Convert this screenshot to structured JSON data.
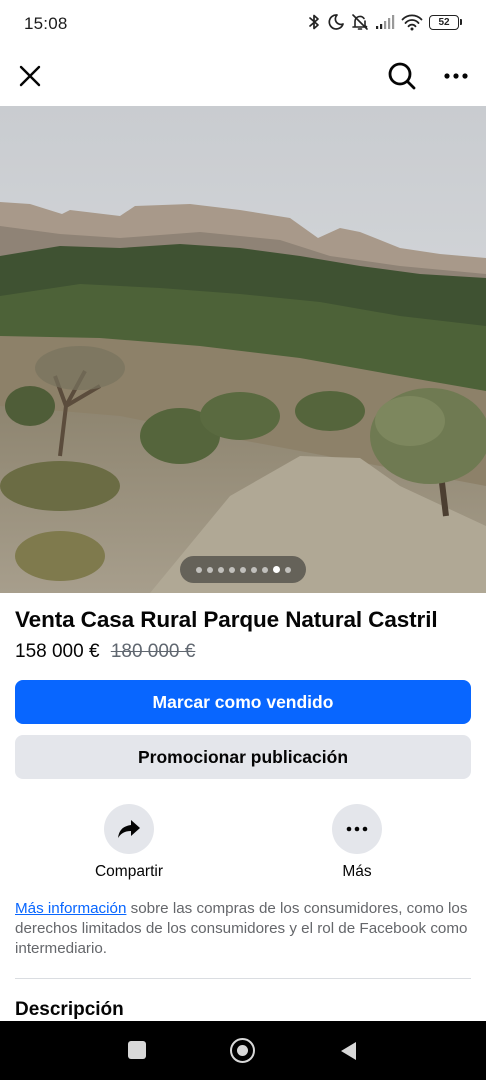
{
  "status_bar": {
    "time": "15:08",
    "battery": "52",
    "icons": [
      "bluetooth-icon",
      "do-not-disturb-icon",
      "bell-off-icon",
      "signal-icon",
      "wifi-icon",
      "battery-icon"
    ]
  },
  "app_bar": {
    "icons": [
      "close-icon",
      "search-icon",
      "more-icon"
    ]
  },
  "photo": {
    "image_count": 9,
    "active_index": 7
  },
  "listing": {
    "title": "Venta Casa Rural Parque Natural Castril",
    "price": "158 000 €",
    "old_price": "180 000 €"
  },
  "buttons": {
    "mark_sold": "Marcar como vendido",
    "promote": "Promocionar publicación"
  },
  "actions": {
    "share_label": "Compartir",
    "more_label": "Más"
  },
  "info": {
    "link_text": "Más información",
    "text": " sobre las compras de los consumidores, como los derechos limitados de los consumidores y el rol de Facebook como intermediario."
  },
  "description": {
    "heading": "Descripción"
  },
  "colors": {
    "primary": "#0866ff",
    "secondary_button": "#e4e6eb",
    "muted_text": "#65676b"
  }
}
